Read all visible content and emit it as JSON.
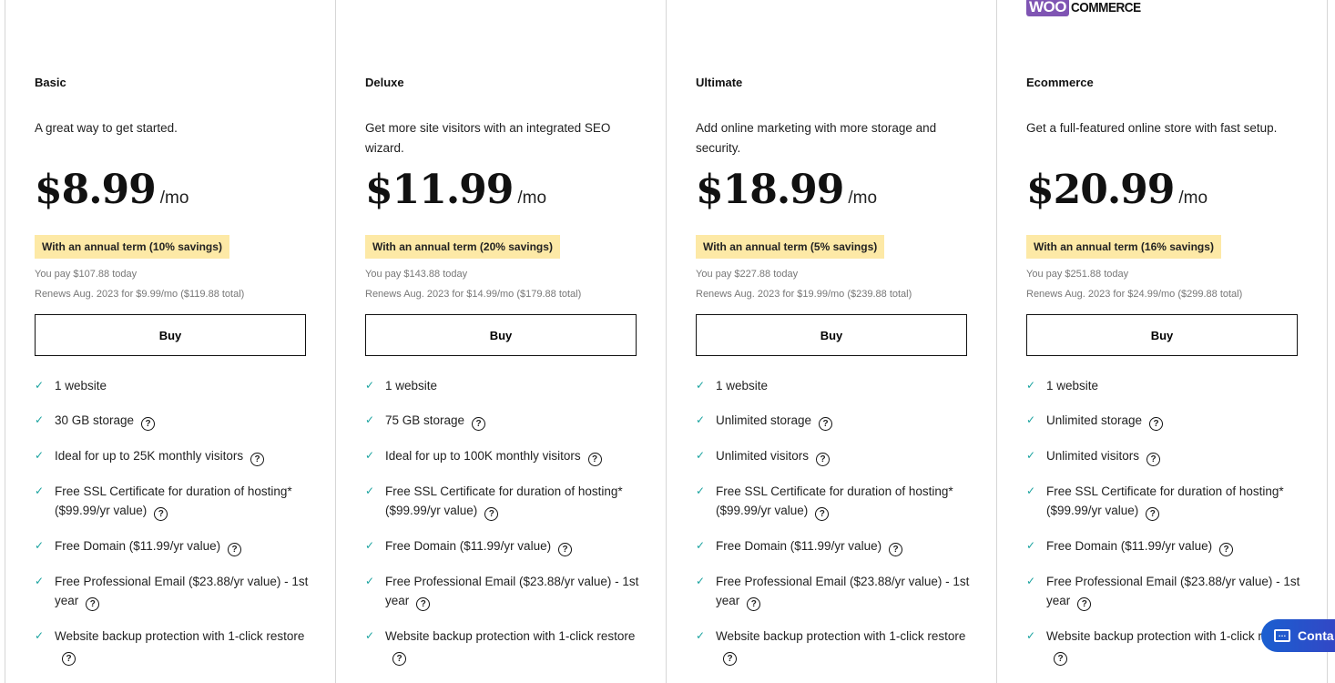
{
  "logo_text": "WOO COMMERCE",
  "colors": {
    "check": "#1ba3a0",
    "badge": "#fde9a6",
    "logo": "#7f54b3",
    "contact": "#1a5fd0"
  },
  "plans": [
    {
      "title": "Basic",
      "desc": "A great way to get started.",
      "price": "$8.99",
      "per": "/mo",
      "badge": "With an annual term (10% savings)",
      "pay": "You pay $107.88 today",
      "renew": "Renews Aug. 2023 for $9.99/mo ($119.88 total)",
      "buy": "Buy",
      "features": [
        {
          "text": "1 website",
          "help": false
        },
        {
          "text": "30 GB storage",
          "help": true
        },
        {
          "text": "Ideal for up to 25K monthly visitors",
          "help": true
        },
        {
          "text": "Free SSL Certificate for duration of hosting* ($99.99/yr value)",
          "help": true
        },
        {
          "text": "Free Domain ($11.99/yr value)",
          "help": true
        },
        {
          "text": "Free Professional Email ($23.88/yr value) - 1st year",
          "help": true
        },
        {
          "text": "Website backup protection with 1-click restore",
          "help": true
        }
      ]
    },
    {
      "title": "Deluxe",
      "desc": "Get more site visitors with an integrated SEO wizard.",
      "price": "$11.99",
      "per": "/mo",
      "badge": "With an annual term (20% savings)",
      "pay": "You pay $143.88 today",
      "renew": "Renews Aug. 2023 for $14.99/mo ($179.88 total)",
      "buy": "Buy",
      "features": [
        {
          "text": "1 website",
          "help": false
        },
        {
          "text": "75 GB storage",
          "help": true
        },
        {
          "text": "Ideal for up to 100K monthly visitors",
          "help": true
        },
        {
          "text": "Free SSL Certificate for duration of hosting* ($99.99/yr value)",
          "help": true
        },
        {
          "text": "Free Domain ($11.99/yr value)",
          "help": true
        },
        {
          "text": "Free Professional Email ($23.88/yr value) - 1st year",
          "help": true
        },
        {
          "text": "Website backup protection with 1-click restore",
          "help": true
        }
      ]
    },
    {
      "title": "Ultimate",
      "desc": "Add online marketing with more storage and security.",
      "price": "$18.99",
      "per": "/mo",
      "badge": "With an annual term (5% savings)",
      "pay": "You pay $227.88 today",
      "renew": "Renews Aug. 2023 for $19.99/mo ($239.88 total)",
      "buy": "Buy",
      "features": [
        {
          "text": "1 website",
          "help": false
        },
        {
          "text": "Unlimited storage",
          "help": true
        },
        {
          "text": "Unlimited visitors",
          "help": true
        },
        {
          "text": "Free SSL Certificate for duration of hosting* ($99.99/yr value)",
          "help": true
        },
        {
          "text": "Free Domain ($11.99/yr value)",
          "help": true
        },
        {
          "text": "Free Professional Email ($23.88/yr value) - 1st year",
          "help": true
        },
        {
          "text": "Website backup protection with 1-click restore",
          "help": true
        }
      ]
    },
    {
      "title": "Ecommerce",
      "desc": "Get a full-featured online store with fast setup.",
      "price": "$20.99",
      "per": "/mo",
      "badge": "With an annual term (16% savings)",
      "pay": "You pay $251.88 today",
      "renew": "Renews Aug. 2023 for $24.99/mo ($299.88 total)",
      "buy": "Buy",
      "features": [
        {
          "text": "1 website",
          "help": false
        },
        {
          "text": "Unlimited storage",
          "help": true
        },
        {
          "text": "Unlimited visitors",
          "help": true
        },
        {
          "text": "Free SSL Certificate for duration of hosting* ($99.99/yr value)",
          "help": true
        },
        {
          "text": "Free Domain ($11.99/yr value)",
          "help": true
        },
        {
          "text": "Free Professional Email ($23.88/yr value) - 1st year",
          "help": true
        },
        {
          "text": "Website backup protection with 1-click restore",
          "help": true
        }
      ]
    }
  ],
  "contact": {
    "label": "Conta"
  }
}
